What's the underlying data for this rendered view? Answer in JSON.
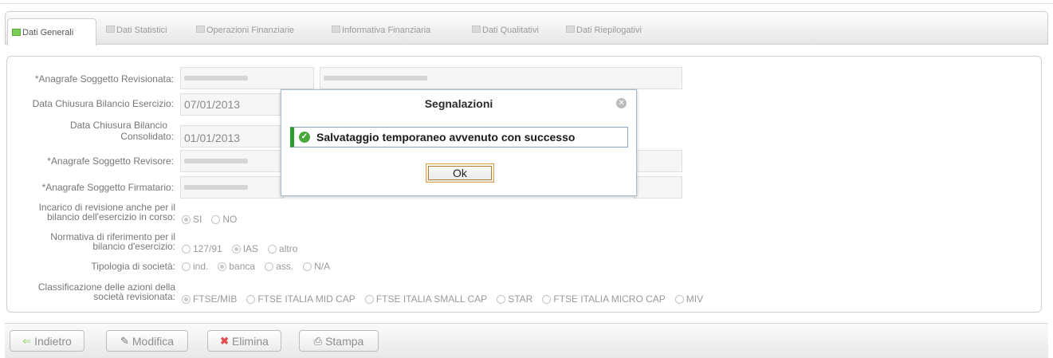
{
  "tabs": [
    {
      "label": "Dati Generali",
      "active": true
    },
    {
      "label": "Dati Statistici",
      "active": false
    },
    {
      "label": "Operazioni Finanziarie",
      "active": false
    },
    {
      "label": "Informativa Finanziaria",
      "active": false
    },
    {
      "label": "Dati Qualitativi",
      "active": false
    },
    {
      "label": "Dati Riepilogativi",
      "active": false
    }
  ],
  "form": {
    "anagrafe_revisionata_label": "*Anagrafe Soggetto Revisionata:",
    "data_chiusura_esercizio_label": "Data Chiusura Bilancio Esercizio:",
    "data_chiusura_esercizio_value": "07/01/2013",
    "data_chiusura_consolidato_label_1": "Data Chiusura Bilancio",
    "data_chiusura_consolidato_label_2": "Consolidato:",
    "data_chiusura_consolidato_value": "01/01/2013",
    "anagrafe_revisore_label": "*Anagrafe Soggetto Revisore:",
    "anagrafe_firmatario_label": "*Anagrafe Soggetto Firmatario:",
    "incarico_label_1": "Incarico di revisione anche per il",
    "incarico_label_2": "bilancio dell'esercizio in corso:",
    "incarico_options": [
      "SI",
      "NO"
    ],
    "incarico_selected": "SI",
    "normativa_label_1": "Normativa di riferimento per il",
    "normativa_label_2": "bilancio d'esercizio:",
    "normativa_options": [
      "127/91",
      "IAS",
      "altro"
    ],
    "normativa_selected": "IAS",
    "tipologia_label": "Tipologia di società:",
    "tipologia_options": [
      "ind.",
      "banca",
      "ass.",
      "N/A"
    ],
    "tipologia_selected": "banca",
    "classificazione_label_1": "Classificazione delle azioni della",
    "classificazione_label_2": "società revisionata:",
    "classificazione_options": [
      "FTSE/MIB",
      "FTSE ITALIA MID CAP",
      "FTSE ITALIA SMALL CAP",
      "STAR",
      "FTSE ITALIA MICRO CAP",
      "MIV"
    ],
    "classificazione_selected": "FTSE/MIB"
  },
  "footer": {
    "back_label": "Indietro",
    "edit_label": "Modifica",
    "delete_label": "Elimina",
    "print_label": "Stampa"
  },
  "dialog": {
    "title": "Segnalazioni",
    "message": "Salvataggio temporaneo avvenuto con successo",
    "ok_label": "Ok"
  },
  "colors": {
    "success": "#2e9b2e",
    "active_tab_icon": "#7ccd54",
    "delete_icon": "#e05050"
  }
}
